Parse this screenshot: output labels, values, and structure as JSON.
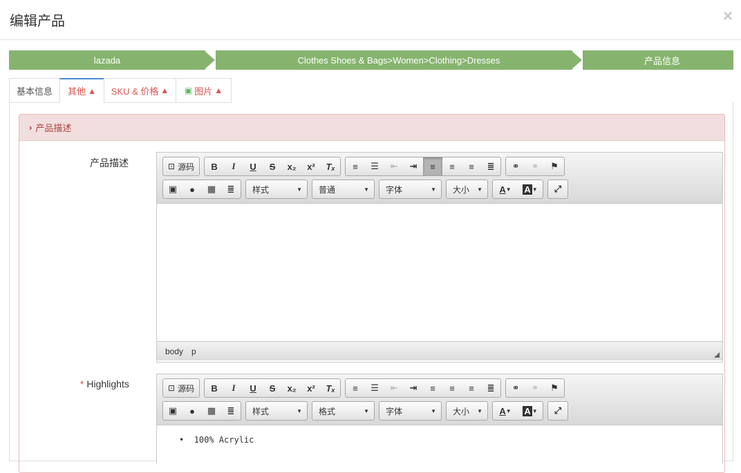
{
  "modal": {
    "title": "编辑产品",
    "close": "×"
  },
  "wizard": [
    "lazada",
    "Clothes Shoes & Bags>Women>Clothing>Dresses",
    "产品信息"
  ],
  "tabs": [
    "基本信息",
    "其他",
    "SKU & 价格",
    "图片"
  ],
  "panel": {
    "title": "产品描述"
  },
  "fields": {
    "description": {
      "label": "产品描述",
      "format": "样式",
      "block": "普通",
      "font": "字体",
      "size": "大小",
      "source": "源码"
    },
    "highlights": {
      "required": "*",
      "label": "Highlights",
      "format": "样式",
      "block": "格式",
      "font": "字体",
      "size": "大小",
      "source": "源码",
      "bullet": "100% Acrylic"
    }
  },
  "statusbar": {
    "path1": "body",
    "path2": "p"
  },
  "colors": {
    "wizard": "#86b46e",
    "warning": "#d9534f",
    "panel_bg": "#f2dede"
  }
}
